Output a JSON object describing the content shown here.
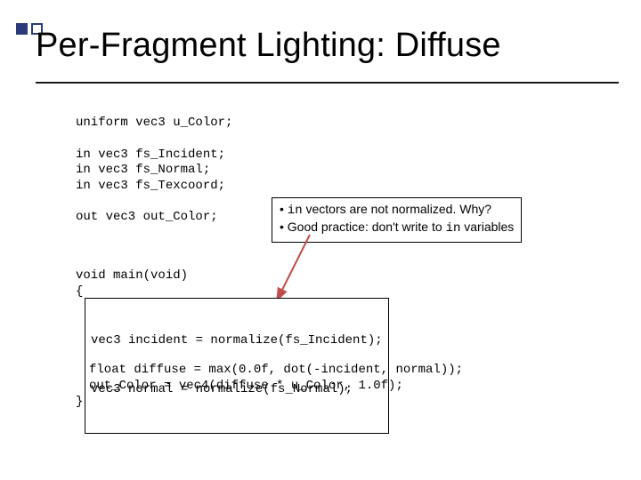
{
  "title": "Per-Fragment Lighting:  Diffuse",
  "code": {
    "uniform": "uniform vec3 u_Color;",
    "ins": "in vec3 fs_Incident;\nin vec3 fs_Normal;\nin vec3 fs_Texcoord;",
    "out": "out vec3 out_Color;",
    "fn_head": "void main(void)",
    "fn_open": "{",
    "hl_line1": "vec3 incident = normalize(fs_Incident);",
    "hl_line2": "vec3 normal = normalize(fs_Normal);",
    "tail_line1": "float diffuse = max(0.0f, dot(-incident, normal));",
    "tail_line2": "out_Color = vec4(diffuse * u_Color, 1.0f);",
    "fn_close": "}"
  },
  "callout": {
    "b1_pre": "• ",
    "b1_mono": "in",
    "b1_post": " vectors are not normalized.  Why?",
    "b2_pre": "• Good practice:  don't write to ",
    "b2_mono": "in",
    "b2_post": " variables"
  }
}
